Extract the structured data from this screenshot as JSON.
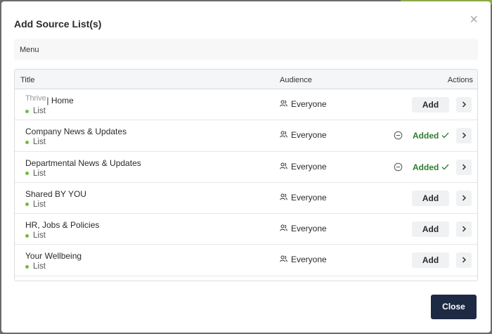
{
  "dialog": {
    "title": "Add Source List(s)",
    "close_symbol": "×",
    "close_button_label": "Close"
  },
  "menu": {
    "label": "Menu"
  },
  "table": {
    "headers": {
      "title": "Title",
      "audience": "Audience",
      "actions": "Actions"
    },
    "rows": [
      {
        "brand": "Thrive",
        "title": "| Home",
        "type": "List",
        "audience": "Everyone",
        "status": "add",
        "action_label": "Add"
      },
      {
        "title": "Company News & Updates",
        "type": "List",
        "audience": "Everyone",
        "status": "added",
        "action_label": "Added"
      },
      {
        "title": "Departmental News & Updates",
        "type": "List",
        "audience": "Everyone",
        "status": "added",
        "action_label": "Added"
      },
      {
        "title": "Shared BY YOU",
        "type": "List",
        "audience": "Everyone",
        "status": "add",
        "action_label": "Add"
      },
      {
        "title": "HR, Jobs & Policies",
        "type": "List",
        "audience": "Everyone",
        "status": "add",
        "action_label": "Add"
      },
      {
        "title": "Your Wellbeing",
        "type": "List",
        "audience": "Everyone",
        "status": "add",
        "action_label": "Add"
      }
    ]
  },
  "icons": {
    "audience": "people-icon",
    "remove": "minus-circle-icon",
    "added": "check-icon",
    "expand": "chevron-right-icon"
  },
  "colors": {
    "primary_button": "#1e2a43",
    "added_text": "#2e7d32",
    "list_dot": "#6fbf3a"
  }
}
